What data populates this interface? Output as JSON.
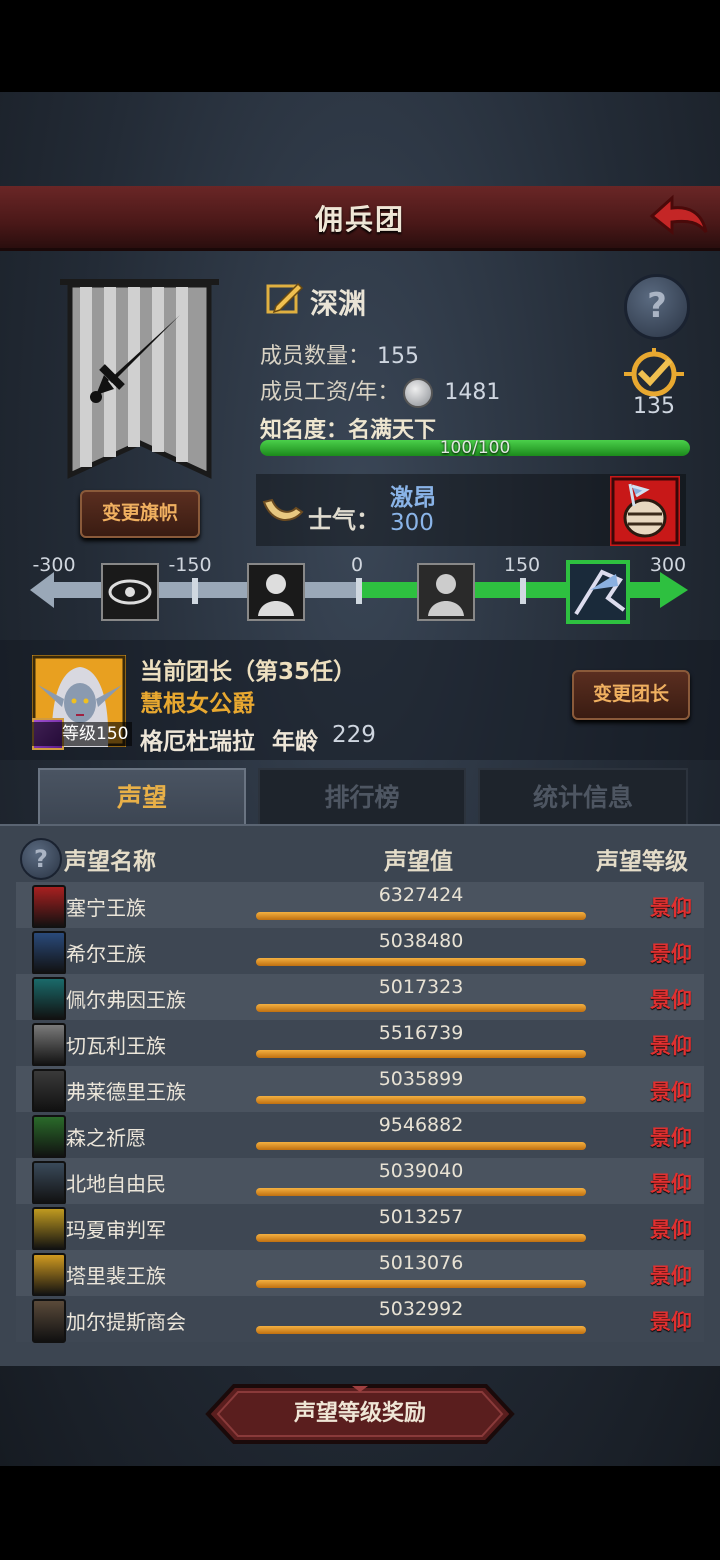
{
  "header": {
    "title": "佣兵团"
  },
  "guild": {
    "name": "深渊",
    "members_label": "成员数量：",
    "members": "155",
    "salary_label": "成员工资/年：",
    "salary": "1481",
    "fame_label": "知名度：",
    "fame_title": "名满天下",
    "fame_progress_text": "100/100",
    "fame_progress": 1.0,
    "change_flag_label": "变更旗帜",
    "medal_count": "135"
  },
  "morale": {
    "label": "士气：",
    "state": "激昂",
    "value": "300",
    "scale_ticks": [
      "-300",
      "-150",
      "0",
      "150",
      "300"
    ],
    "level_fraction": 1.0
  },
  "leader": {
    "title": "当前团长（第35任）",
    "rank": "慧根女公爵",
    "name": "格厄杜瑞拉",
    "age_label": "年龄",
    "age": "229",
    "level": "等级150",
    "change_label": "变更团长"
  },
  "tabs": [
    {
      "label": "声望",
      "active": true
    },
    {
      "label": "排行榜",
      "active": false
    },
    {
      "label": "统计信息",
      "active": false
    }
  ],
  "table": {
    "headers": [
      "声望名称",
      "声望值",
      "声望等级"
    ],
    "rows": [
      {
        "name": "塞宁王族",
        "value": "6327424",
        "level": "景仰",
        "color": "#a82020"
      },
      {
        "name": "希尔王族",
        "value": "5038480",
        "level": "景仰",
        "color": "#2a4a7a"
      },
      {
        "name": "佩尔弗因王族",
        "value": "5017323",
        "level": "景仰",
        "color": "#1a6a6a"
      },
      {
        "name": "切瓦利王族",
        "value": "5516739",
        "level": "景仰",
        "color": "#7a7a7a"
      },
      {
        "name": "弗莱德里王族",
        "value": "5035899",
        "level": "景仰",
        "color": "#3a3a3a"
      },
      {
        "name": "森之祈愿",
        "value": "9546882",
        "level": "景仰",
        "color": "#2a6a2a"
      },
      {
        "name": "北地自由民",
        "value": "5039040",
        "level": "景仰",
        "color": "#3a4a5a"
      },
      {
        "name": "玛夏审判军",
        "value": "5013257",
        "level": "景仰",
        "color": "#c09a20"
      },
      {
        "name": "塔里裴王族",
        "value": "5013076",
        "level": "景仰",
        "color": "#d09a20"
      },
      {
        "name": "加尔提斯商会",
        "value": "5032992",
        "level": "景仰",
        "color": "#5a4a3a"
      }
    ]
  },
  "footer": {
    "reward_label": "声望等级奖励"
  }
}
